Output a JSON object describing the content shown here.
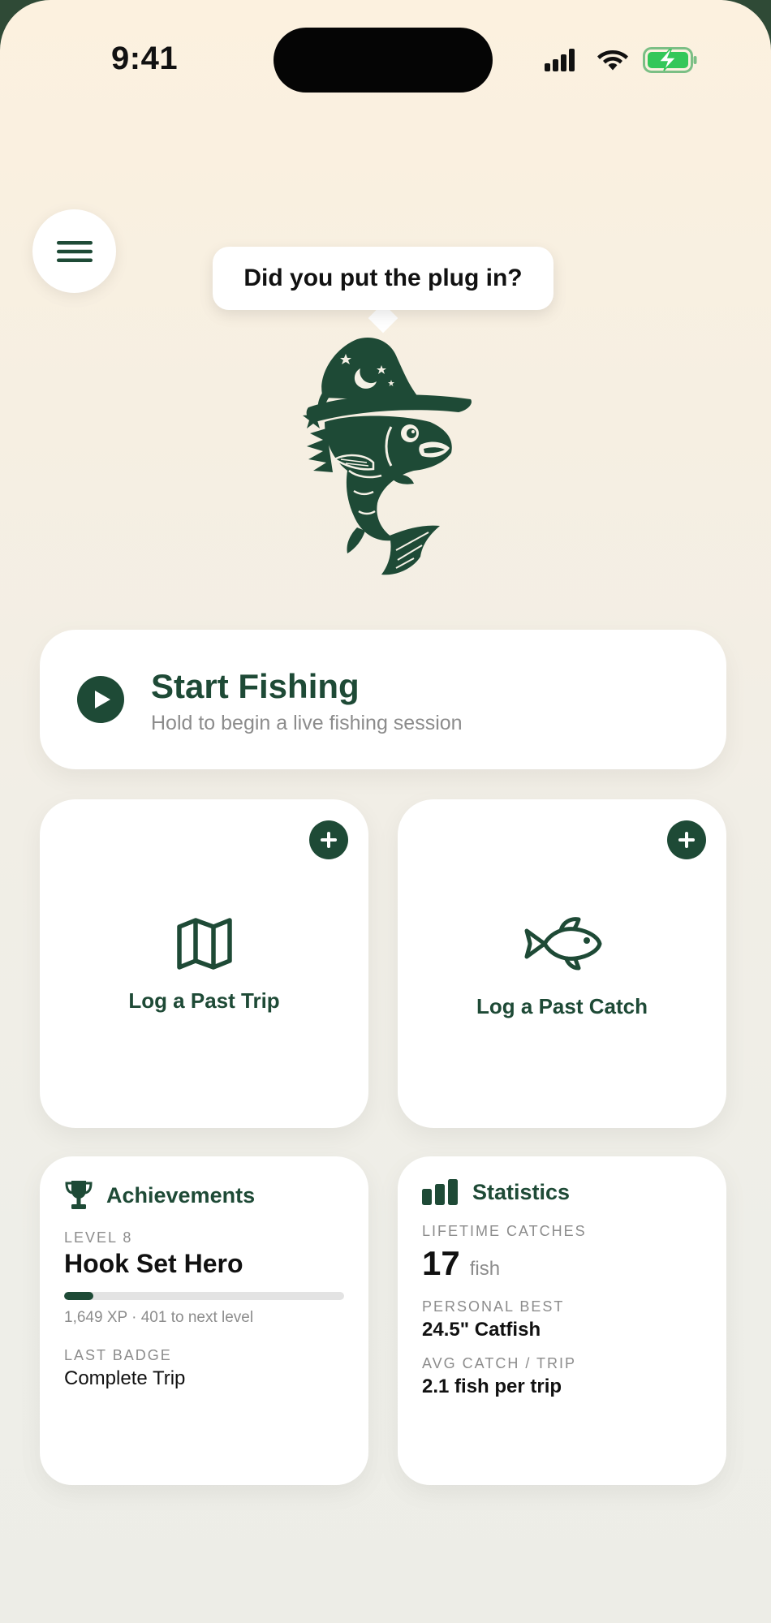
{
  "status_bar": {
    "time": "9:41"
  },
  "speech_bubble": "Did you put the plug in?",
  "start_fishing": {
    "title": "Start Fishing",
    "subtitle": "Hold to begin a live fishing session"
  },
  "log_trip": {
    "label": "Log a Past Trip"
  },
  "log_catch": {
    "label": "Log a Past Catch"
  },
  "achievements": {
    "title": "Achievements",
    "level_label": "LEVEL 8",
    "level_name": "Hook Set Hero",
    "progress_fraction": 0.105,
    "xp_text": "1,649 XP · 401 to next level",
    "last_badge_label": "LAST BADGE",
    "last_badge": "Complete Trip"
  },
  "statistics": {
    "title": "Statistics",
    "lifetime_label": "LIFETIME CATCHES",
    "lifetime_value": "17",
    "lifetime_unit": "fish",
    "personal_best_label": "PERSONAL BEST",
    "personal_best": "24.5\" Catfish",
    "avg_label": "AVG CATCH / TRIP",
    "avg_value": "2.1 fish per trip"
  },
  "colors": {
    "brand_green": "#1e4a36",
    "battery_green": "#34c759"
  },
  "icons": {
    "menu": "hamburger-menu-icon",
    "mascot": "wizard-fish-mascot",
    "play": "play-circle-icon",
    "plus": "plus-icon",
    "map": "map-icon",
    "fish": "fish-icon",
    "trophy": "trophy-icon",
    "bar_chart": "bar-chart-icon"
  }
}
